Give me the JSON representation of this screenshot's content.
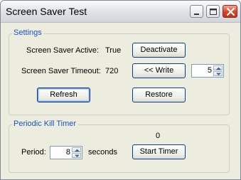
{
  "window": {
    "title": "Screen Saver Test"
  },
  "settings": {
    "legend": "Settings",
    "active_label": "Screen Saver Active:",
    "active_value": "True",
    "deactivate_label": "Deactivate",
    "timeout_label": "Screen Saver Timeout:",
    "timeout_value": "720",
    "write_label": "<<  Write",
    "timeout_spin_value": "5",
    "refresh_label": "Refresh",
    "restore_label": "Restore"
  },
  "kill_timer": {
    "legend": "Periodic Kill Timer",
    "counter": "0",
    "period_label": "Period:",
    "period_value": "8",
    "seconds_label": "seconds",
    "start_label": "Start Timer"
  },
  "icons": {
    "minimize": "minimize-icon",
    "maximize": "maximize-icon",
    "close": "close-icon"
  }
}
